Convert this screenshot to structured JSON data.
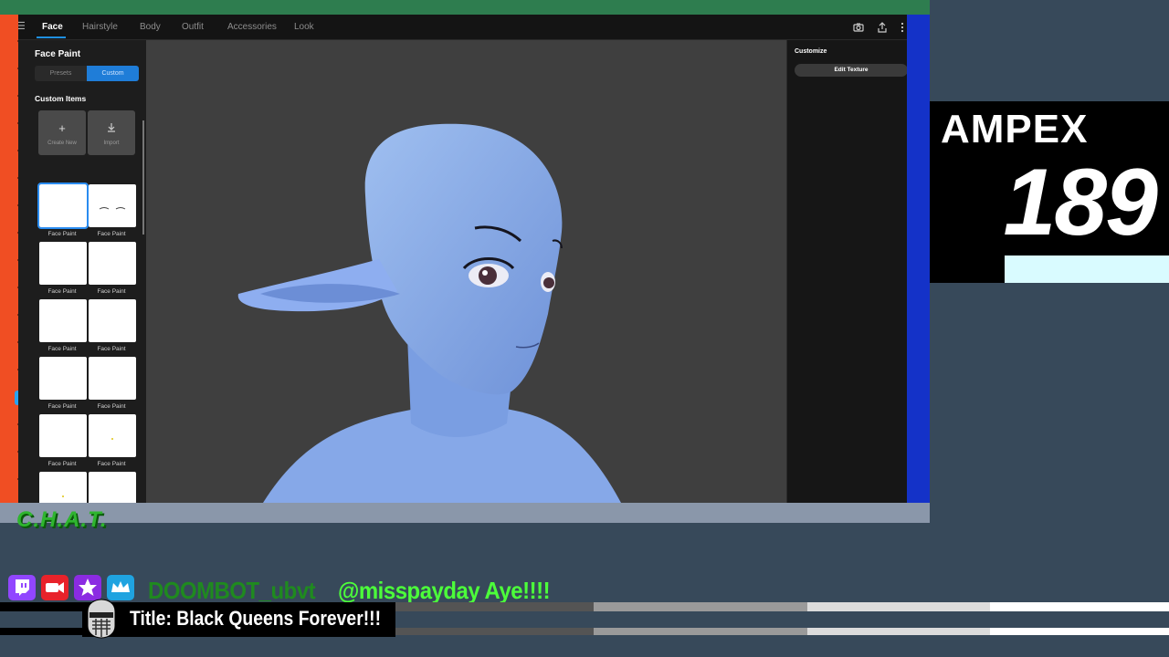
{
  "app": {
    "tabs": [
      {
        "label": "Face",
        "active": true
      },
      {
        "label": "Hairstyle"
      },
      {
        "label": "Body"
      },
      {
        "label": "Outfit"
      },
      {
        "label": "Accessories"
      },
      {
        "label": "Look"
      }
    ],
    "toolbar_icons": [
      "camera-icon",
      "share-icon",
      "more-icon"
    ],
    "left_panel": {
      "title": "Face Paint",
      "segments": [
        "Presets",
        "Custom"
      ],
      "active_segment": "Custom",
      "custom_items_title": "Custom Items",
      "actions": [
        {
          "label": "Create New",
          "icon": "plus-icon"
        },
        {
          "label": "Import",
          "icon": "import-icon"
        }
      ],
      "items": [
        {
          "label": "Face Paint",
          "selected": true
        },
        {
          "label": "Face Paint"
        },
        {
          "label": "Face Paint"
        },
        {
          "label": "Face Paint"
        },
        {
          "label": "Face Paint"
        },
        {
          "label": "Face Paint"
        },
        {
          "label": "Face Paint"
        },
        {
          "label": "Face Paint"
        },
        {
          "label": "Face Paint"
        },
        {
          "label": "Face Paint"
        },
        {
          "label": "Face Paint"
        },
        {
          "label": "Face Paint"
        }
      ]
    },
    "right_panel": {
      "title": "Customize",
      "button": "Edit Texture"
    }
  },
  "overlay": {
    "ampex_title": "AMPEX",
    "ampex_number": "189",
    "chat_logo": "C.H.A.T.",
    "chat_username": "DOOMBOT_ubvt",
    "chat_message": "@misspayday Aye!!!!",
    "stream_title": "Title: Black Queens Forever!!!",
    "platform_icons": [
      "twitch-icon",
      "video-icon",
      "star-icon",
      "crown-icon"
    ],
    "colors": {
      "accent_blue": "#1f8fe0",
      "frame_orange": "#f04e23",
      "frame_green": "#2e7d4f",
      "frame_blue": "#1432c8",
      "chat_green": "#4cff3a"
    }
  }
}
